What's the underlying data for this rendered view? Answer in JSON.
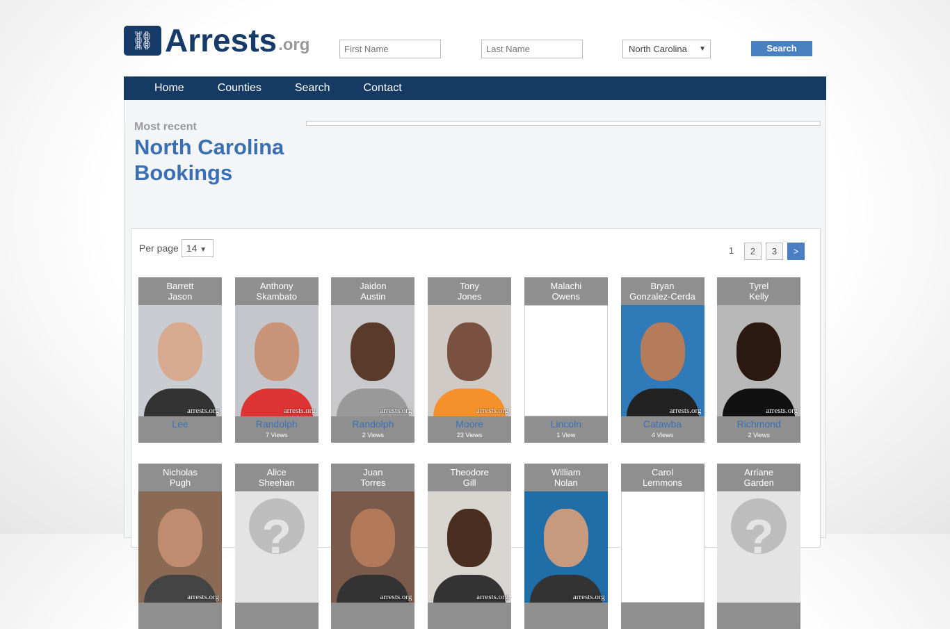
{
  "logo": {
    "main": "Arrests",
    "suffix": ".org"
  },
  "search": {
    "first_placeholder": "First Name",
    "last_placeholder": "Last Name",
    "state": "North Carolina",
    "button": "Search"
  },
  "nav": [
    "Home",
    "Counties",
    "Search",
    "Contact"
  ],
  "heading": {
    "kicker": "Most recent",
    "title": "North Carolina Bookings"
  },
  "list": {
    "per_page_label": "Per page",
    "per_page": "14",
    "pages": [
      "1",
      "2",
      "3"
    ],
    "next": ">"
  },
  "watermark": "arrests.org",
  "cards": [
    {
      "first": "Barrett",
      "last": "Jason",
      "county": "Lee",
      "views": "",
      "photo": "photo",
      "bg": "#c9ccd1",
      "skin": "#d7a98f",
      "shirt": "#333"
    },
    {
      "first": "Anthony",
      "last": "Skambato",
      "county": "Randolph",
      "views": "7 Views",
      "photo": "photo",
      "bg": "#c4c6cb",
      "skin": "#c99378",
      "shirt": "#d33"
    },
    {
      "first": "Jaidon",
      "last": "Austin",
      "county": "Randolph",
      "views": "2 Views",
      "photo": "photo",
      "bg": "#c9c9cb",
      "skin": "#5a3a2a",
      "shirt": "#999"
    },
    {
      "first": "Tony",
      "last": "Jones",
      "county": "Moore",
      "views": "23 Views",
      "photo": "photo",
      "bg": "#cfcac6",
      "skin": "#7a5040",
      "shirt": "#f5912b"
    },
    {
      "first": "Malachi",
      "last": "Owens",
      "county": "Lincoln",
      "views": "1 View",
      "photo": "broken"
    },
    {
      "first": "Bryan",
      "last": "Gonzalez-Cerda",
      "county": "Catawba",
      "views": "4 Views",
      "photo": "photo",
      "bg": "#2f7ab8",
      "skin": "#b57c5c",
      "shirt": "#222"
    },
    {
      "first": "Tyrel",
      "last": "Kelly",
      "county": "Richmond",
      "views": "2 Views",
      "photo": "photo",
      "bg": "#b8b8b8",
      "skin": "#2c1a12",
      "shirt": "#111"
    },
    {
      "first": "Nicholas",
      "last": "Pugh",
      "county": "",
      "views": "",
      "photo": "photo",
      "bg": "#8a6a55",
      "skin": "#c08b6e",
      "shirt": "#444"
    },
    {
      "first": "Alice",
      "last": "Sheehan",
      "county": "",
      "views": "",
      "photo": "unknown"
    },
    {
      "first": "Juan",
      "last": "Torres",
      "county": "",
      "views": "",
      "photo": "photo",
      "bg": "#7a5a4a",
      "skin": "#b37a5a",
      "shirt": "#333"
    },
    {
      "first": "Theodore",
      "last": "Gill",
      "county": "",
      "views": "",
      "photo": "photo",
      "bg": "#d8d4cf",
      "skin": "#4a2e22",
      "shirt": "#333"
    },
    {
      "first": "William",
      "last": "Nolan",
      "county": "",
      "views": "",
      "photo": "photo",
      "bg": "#1f6ea8",
      "skin": "#c79a80",
      "shirt": "#333"
    },
    {
      "first": "Carol",
      "last": "Lemmons",
      "county": "",
      "views": "",
      "photo": "broken"
    },
    {
      "first": "Arriane",
      "last": "Garden",
      "county": "",
      "views": "",
      "photo": "unknown"
    }
  ]
}
